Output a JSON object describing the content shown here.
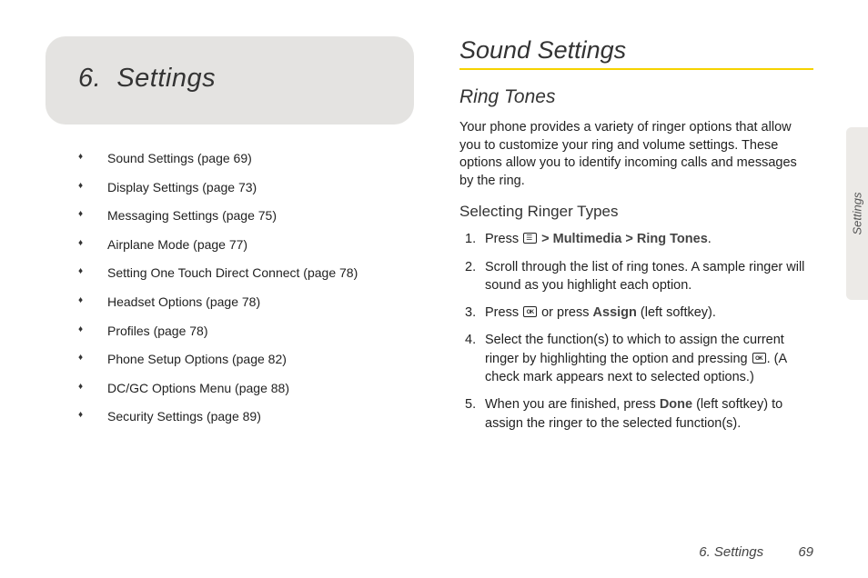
{
  "chapter": {
    "number": "6.",
    "title": "Settings"
  },
  "toc": [
    "Sound Settings (page 69)",
    "Display Settings (page 73)",
    "Messaging Settings (page 75)",
    "Airplane Mode (page 77)",
    "Setting One Touch Direct Connect (page 78)",
    "Headset Options (page 78)",
    "Profiles (page 78)",
    "Phone Setup Options (page 82)",
    "DC/GC Options Menu (page 88)",
    "Security Settings (page 89)"
  ],
  "section": {
    "h1": "Sound Settings",
    "h2": "Ring Tones",
    "intro": "Your phone provides a variety of ringer options that allow you to customize your ring and volume settings. These options allow you to identify incoming calls and messages by the ring.",
    "h3": "Selecting Ringer Types",
    "steps": {
      "s1a": "Press ",
      "s1b": " > ",
      "s1c": "Multimedia",
      "s1d": " > ",
      "s1e": "Ring Tones",
      "s1f": ".",
      "s2": "Scroll through the list of ring tones. A sample ringer will sound as you highlight each option.",
      "s3a": "Press ",
      "s3b": " or press ",
      "s3c": "Assign",
      "s3d": " (left softkey).",
      "s4a": "Select the function(s) to which to assign the current ringer by highlighting the option and pressing ",
      "s4b": ". (A check mark appears next to selected options.)",
      "s5a": "When you are finished, press ",
      "s5b": "Done",
      "s5c": " (left softkey) to assign the ringer to the selected function(s)."
    }
  },
  "sidetab": "Settings",
  "footer": {
    "label": "6. Settings",
    "page": "69"
  }
}
